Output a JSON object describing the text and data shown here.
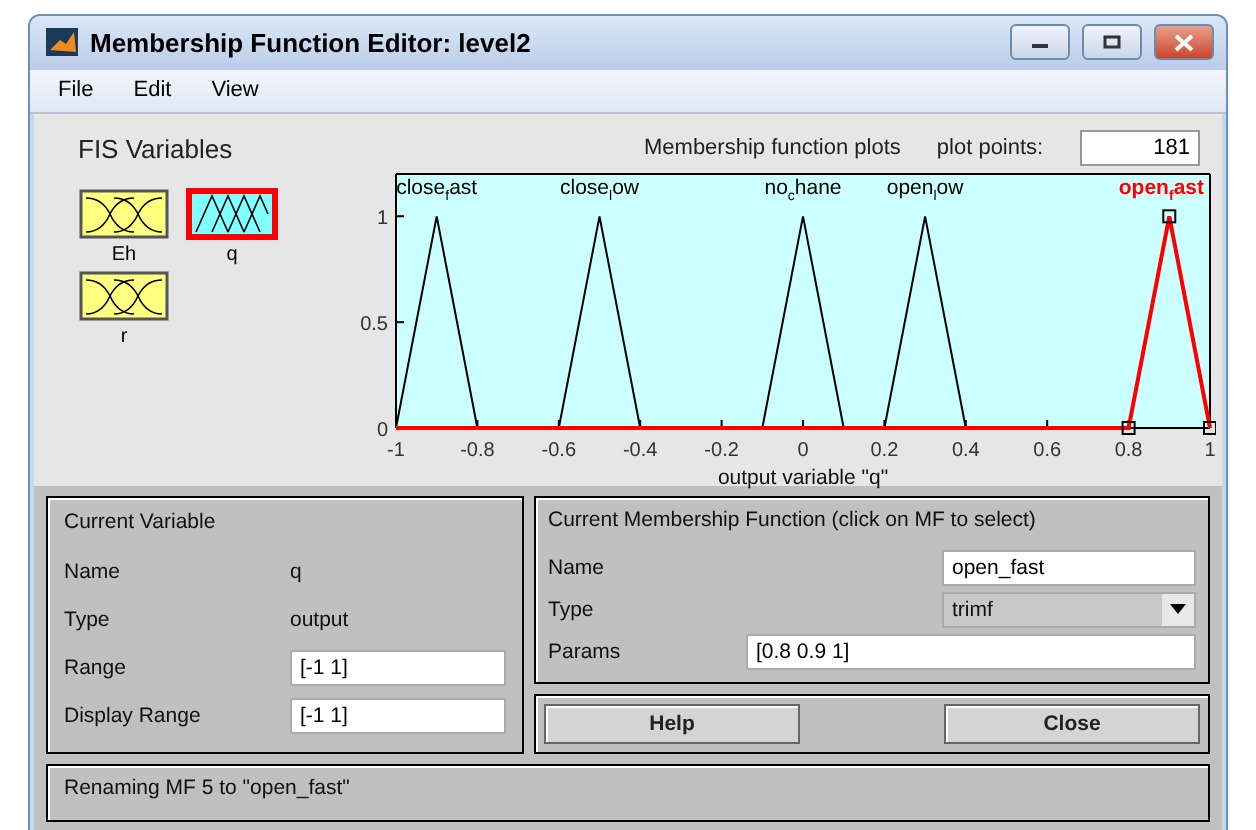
{
  "window": {
    "title": "Membership Function Editor: level2"
  },
  "menu": [
    "File",
    "Edit",
    "View"
  ],
  "fis_variables": {
    "title": "FIS Variables",
    "items": [
      {
        "name": "Eh",
        "kind": "input",
        "selected": false
      },
      {
        "name": "q",
        "kind": "output",
        "selected": true
      },
      {
        "name": "r",
        "kind": "input",
        "selected": false
      }
    ]
  },
  "plot": {
    "title": "Membership function plots",
    "plot_points_label": "plot points:",
    "plot_points": "181",
    "mf_selection": [
      {
        "selected": false
      },
      {
        "selected": false
      },
      {
        "selected": false
      },
      {
        "selected": false
      },
      {
        "selected": true
      }
    ],
    "chart_data": {
      "type": "line",
      "xlabel": "output variable \"q\"",
      "xlim": [
        -1,
        1
      ],
      "ylim": [
        0,
        1.2
      ],
      "xticks": [
        -1,
        -0.8,
        -0.6,
        -0.4,
        -0.2,
        0,
        0.2,
        0.4,
        0.6,
        0.8,
        1
      ],
      "yticks": [
        0,
        0.5,
        1
      ],
      "x": [
        -1,
        -0.9,
        -0.8,
        -0.7,
        -0.6,
        -0.5,
        -0.4,
        -0.3,
        -0.2,
        -0.1,
        0,
        0.1,
        0.2,
        0.3,
        0.4,
        0.5,
        0.6,
        0.7,
        0.8,
        0.9,
        1
      ],
      "series": [
        {
          "name": "close$_{f}$ast",
          "color": "#000000",
          "values": [
            0,
            1,
            0,
            null,
            null,
            null,
            null,
            null,
            null,
            null,
            null,
            null,
            null,
            null,
            null,
            null,
            null,
            null,
            null,
            null,
            null
          ]
        },
        {
          "name": "close$_{l}$ow",
          "color": "#000000",
          "values": [
            null,
            null,
            null,
            null,
            0,
            1,
            0,
            null,
            null,
            null,
            null,
            null,
            null,
            null,
            null,
            null,
            null,
            null,
            null,
            null,
            null
          ]
        },
        {
          "name": "no$_{c}$hane",
          "color": "#000000",
          "values": [
            null,
            null,
            null,
            null,
            null,
            null,
            null,
            null,
            null,
            0,
            1,
            0,
            null,
            null,
            null,
            null,
            null,
            null,
            null,
            null,
            null
          ]
        },
        {
          "name": "open$_{l}$ow",
          "color": "#000000",
          "values": [
            null,
            null,
            null,
            null,
            null,
            null,
            null,
            null,
            null,
            null,
            null,
            null,
            0,
            1,
            0,
            null,
            null,
            null,
            null,
            null,
            null
          ]
        },
        {
          "name": "open$_{f}$ast",
          "color": "#ff0000",
          "values": [
            0,
            0,
            0,
            0,
            0,
            0,
            0,
            0,
            0,
            0,
            0,
            0,
            0,
            0,
            0,
            0,
            0,
            0,
            0,
            1,
            0
          ]
        }
      ]
    }
  },
  "current_variable": {
    "title": "Current Variable",
    "rows": [
      {
        "label": "Name",
        "value": "q",
        "kind": "text"
      },
      {
        "label": "Type",
        "value": "output",
        "kind": "text"
      },
      {
        "label": "Range",
        "value": "[-1 1]",
        "kind": "field"
      },
      {
        "label": "Display Range",
        "value": "[-1 1]",
        "kind": "field"
      }
    ]
  },
  "current_mf": {
    "title": "Current Membership Function (click on MF to select)",
    "name_label": "Name",
    "name": "open_fast",
    "type_label": "Type",
    "type": "trimf",
    "params_label": "Params",
    "params": "[0.8 0.9 1]"
  },
  "buttons": [
    "Help",
    "Close"
  ],
  "status": "Renaming MF 5 to \"open_fast\""
}
